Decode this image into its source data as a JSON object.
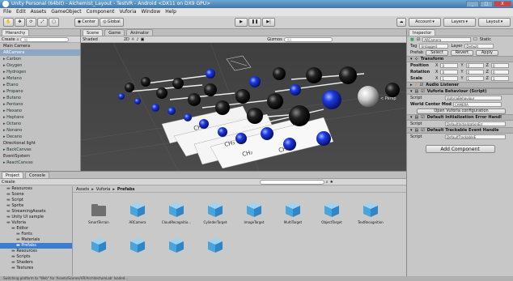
{
  "window": {
    "title": "Unity Personal (64bit) - Alchemist_Layout - TestVR - Android <DX11 on DX9 GPU>",
    "buttons": [
      "_",
      "□",
      "X"
    ]
  },
  "menu": [
    "File",
    "Edit",
    "Assets",
    "GameObject",
    "Component",
    "Vuforia",
    "Window",
    "Help"
  ],
  "toolbar": {
    "pivot_label": "Center",
    "space_label": "Global",
    "account_label": "Account",
    "layers_label": "Layers",
    "layout_label": "Layout"
  },
  "hierarchy": {
    "tab": "Hierarchy",
    "create": "Create",
    "search_placeholder": "All",
    "items": [
      {
        "label": "Main Camera",
        "child": false,
        "sel": false
      },
      {
        "label": "ARCamera",
        "child": false,
        "sel": true
      },
      {
        "label": "Carbon",
        "child": true,
        "sel": false
      },
      {
        "label": "Oxygen",
        "child": true,
        "sel": false
      },
      {
        "label": "Hydrogen",
        "child": true,
        "sel": false
      },
      {
        "label": "Metano",
        "child": true,
        "sel": false
      },
      {
        "label": "Etano",
        "child": true,
        "sel": false
      },
      {
        "label": "Propano",
        "child": true,
        "sel": false
      },
      {
        "label": "Butano",
        "child": true,
        "sel": false
      },
      {
        "label": "Pentano",
        "child": true,
        "sel": false
      },
      {
        "label": "Hexano",
        "child": true,
        "sel": false
      },
      {
        "label": "Heptano",
        "child": true,
        "sel": false
      },
      {
        "label": "Octano",
        "child": true,
        "sel": false
      },
      {
        "label": "Nonano",
        "child": true,
        "sel": false
      },
      {
        "label": "Decano",
        "child": true,
        "sel": false
      },
      {
        "label": "Directional light",
        "child": false,
        "sel": false
      },
      {
        "label": "BackCanvas",
        "child": true,
        "sel": false
      },
      {
        "label": "EventSystem",
        "child": false,
        "sel": false
      },
      {
        "label": "ReactCanvas",
        "child": true,
        "sel": false
      }
    ]
  },
  "scene": {
    "tabs": [
      "Scene",
      "Game",
      "Animator"
    ],
    "shading": "Shaded",
    "mode2d": "2D",
    "gizmos": "Gizmos",
    "search_placeholder": "All",
    "persp_label": "< Persp",
    "card_labels": [
      "CH₄",
      "CH₃",
      "CH₂",
      "CH₂"
    ]
  },
  "inspector": {
    "tab": "Inspector",
    "object_name": "ARCamera",
    "static_label": "Static",
    "tag_label": "Tag",
    "tag_value": "Untagged",
    "layer_label": "Layer",
    "layer_value": "Default",
    "prefab_buttons": [
      "Prefab",
      "Select",
      "Revert",
      "Apply"
    ],
    "transform": {
      "title": "Transform",
      "rows": [
        {
          "label": "Position",
          "x": "0",
          "y": "0",
          "z": "0"
        },
        {
          "label": "Rotation",
          "x": "0",
          "y": "0",
          "z": "0"
        },
        {
          "label": "Scale",
          "x": "1",
          "y": "1",
          "z": "1"
        }
      ]
    },
    "audio_listener": "Audio Listener",
    "vuforia_behaviour": "Vuforia Behaviour (Script)",
    "script_label": "Script",
    "vuforia_script": "VuforiaBehaviour",
    "world_center_label": "World Center Mod",
    "world_center_value": "CAMERA",
    "open_config_button": "Open Vuforia configuration",
    "default_init": "Default Initialization Error Handl",
    "default_init_script": "DefaultInitializationErr",
    "default_trackable": "Default Trackable Event Handle",
    "default_trackable_script": "DefaultTrackableE",
    "add_component_button": "Add Component"
  },
  "project": {
    "tabs": [
      "Project",
      "Console"
    ],
    "create": "Create",
    "breadcrumb": [
      "Assets",
      "Vuforia",
      "Prefabs"
    ],
    "folders": [
      {
        "label": "Resources",
        "indent": 1,
        "sel": false
      },
      {
        "label": "Scene",
        "indent": 1,
        "sel": false
      },
      {
        "label": "Script",
        "indent": 1,
        "sel": false
      },
      {
        "label": "Sprite",
        "indent": 1,
        "sel": false
      },
      {
        "label": "StreamingAssets",
        "indent": 1,
        "sel": false
      },
      {
        "label": "Unity UI sample",
        "indent": 1,
        "sel": false
      },
      {
        "label": "Vuforia",
        "indent": 1,
        "sel": false
      },
      {
        "label": "Editor",
        "indent": 2,
        "sel": false
      },
      {
        "label": "Fonts",
        "indent": 3,
        "sel": false
      },
      {
        "label": "Materials",
        "indent": 3,
        "sel": false
      },
      {
        "label": "Prefabs",
        "indent": 3,
        "sel": true
      },
      {
        "label": "Resources",
        "indent": 2,
        "sel": false
      },
      {
        "label": "Scripts",
        "indent": 2,
        "sel": false
      },
      {
        "label": "Shaders",
        "indent": 2,
        "sel": false
      },
      {
        "label": "Textures",
        "indent": 2,
        "sel": false
      }
    ],
    "assets": [
      {
        "label": "SmartTerrain",
        "kind": "folder"
      },
      {
        "label": "ARCamera",
        "kind": "cube"
      },
      {
        "label": "CloudRecognitio...",
        "kind": "cube"
      },
      {
        "label": "CylinderTarget",
        "kind": "cube"
      },
      {
        "label": "ImageTarget",
        "kind": "cube"
      },
      {
        "label": "MultiTarget",
        "kind": "cube"
      },
      {
        "label": "ObjectTarget",
        "kind": "cube"
      },
      {
        "label": "TextRecognition",
        "kind": "cube"
      },
      {
        "label": "",
        "kind": "cube"
      },
      {
        "label": "",
        "kind": "cube"
      },
      {
        "label": "",
        "kind": "cube"
      },
      {
        "label": "",
        "kind": "cube"
      }
    ]
  },
  "status": "Switching platform to \"Web\" for 'Assets/Scenes/VR/ArchitectureLab' loaded..."
}
